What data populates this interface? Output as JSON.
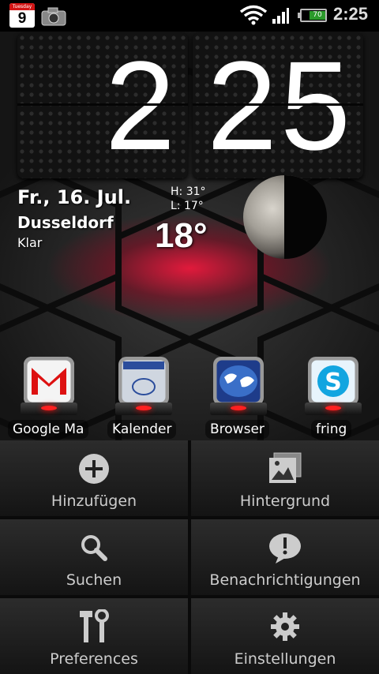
{
  "status_bar": {
    "calendar_day_label": "Tuesday",
    "calendar_day_number": "9",
    "battery_level": "70",
    "time": "2:25",
    "icons": [
      "calendar-icon",
      "camera-icon",
      "wifi-icon",
      "signal-icon",
      "battery-icon"
    ]
  },
  "clock": {
    "hour": "2",
    "minutes": "25"
  },
  "weather": {
    "date": "Fr., 16. Jul.",
    "city": "Dusseldorf",
    "condition": "Klar",
    "high": "H:  31°",
    "low": "L:  17°",
    "temperature": "18°"
  },
  "dock": {
    "apps": [
      {
        "label": "Google Ma",
        "icon": "gmail-icon"
      },
      {
        "label": "Kalender",
        "icon": "calendar-app-icon"
      },
      {
        "label": "Browser",
        "icon": "globe-icon"
      },
      {
        "label": "fring",
        "icon": "skype-icon"
      }
    ]
  },
  "menu": {
    "items": [
      {
        "label": "Hinzufügen",
        "icon": "plus-icon"
      },
      {
        "label": "Hintergrund",
        "icon": "picture-icon"
      },
      {
        "label": "Suchen",
        "icon": "search-icon"
      },
      {
        "label": "Benachrichtigungen",
        "icon": "notification-icon"
      },
      {
        "label": "Preferences",
        "icon": "tools-icon"
      },
      {
        "label": "Einstellungen",
        "icon": "gear-icon"
      }
    ]
  },
  "colors": {
    "accent_red": "#ff1e3c",
    "menu_bg": "#1e1e1e"
  }
}
